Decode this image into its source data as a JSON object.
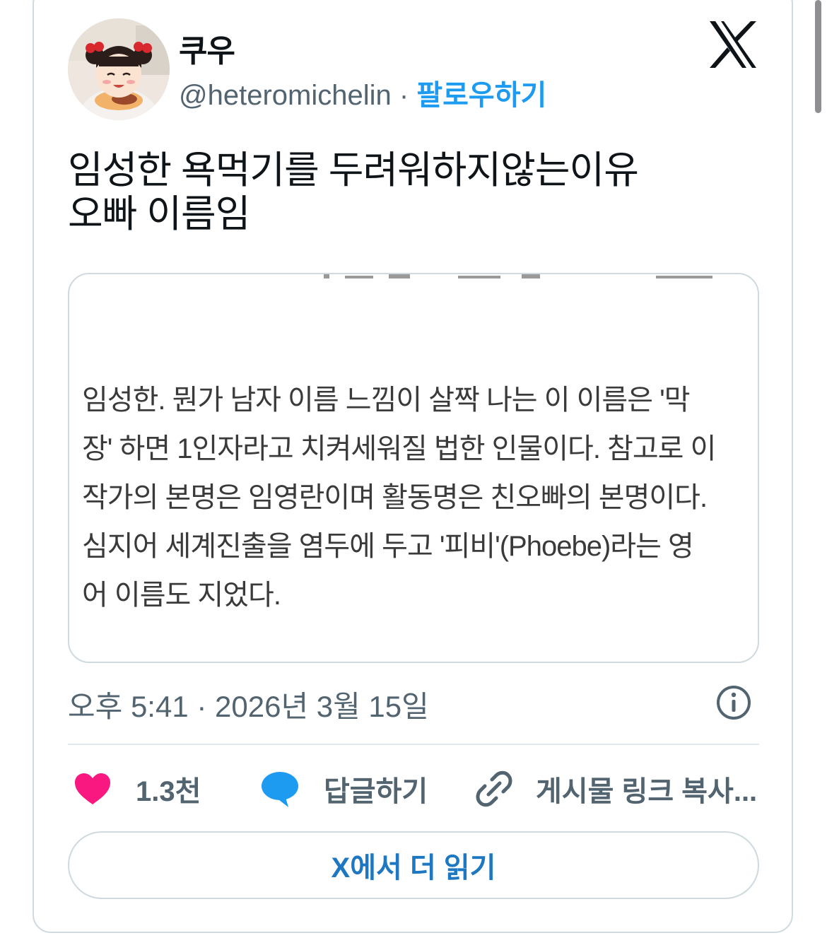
{
  "author": {
    "name": "쿠우",
    "handle": "@heteromichelin",
    "separator": "·",
    "follow_label": "팔로우하기"
  },
  "tweet": {
    "lines": [
      "임성한 욕먹기를 두려워하지않는이유",
      "오빠 이름임"
    ]
  },
  "quoted_image": {
    "lines": [
      "임성한. 뭔가 남자 이름 느낌이 살짝 나는 이 이름은 '막",
      "장' 하면 1인자라고 치켜세워질 법한 인물이다. 참고로 이",
      "작가의 본명은 임영란이며 활동명은 친오빠의 본명이다.",
      "심지어 세계진출을 염두에 두고 '피비'(Phoebe)라는 영",
      "어 이름도 지었다."
    ]
  },
  "timestamp": "오후 5:41 · 2026년 3월 15일",
  "actions": {
    "like_count": "1.3천",
    "reply_label": "답글하기",
    "copy_label": "게시물 링크 복사..."
  },
  "read_more_label": "X에서 더 읽기",
  "colors": {
    "accent": "#1d9bf0",
    "like": "#f91880",
    "reply": "#1d9bf0",
    "muted": "#536471",
    "border": "#cfd9de"
  },
  "icons": [
    "x-logo-icon",
    "info-icon",
    "heart-icon",
    "speech-bubble-icon",
    "link-icon"
  ]
}
